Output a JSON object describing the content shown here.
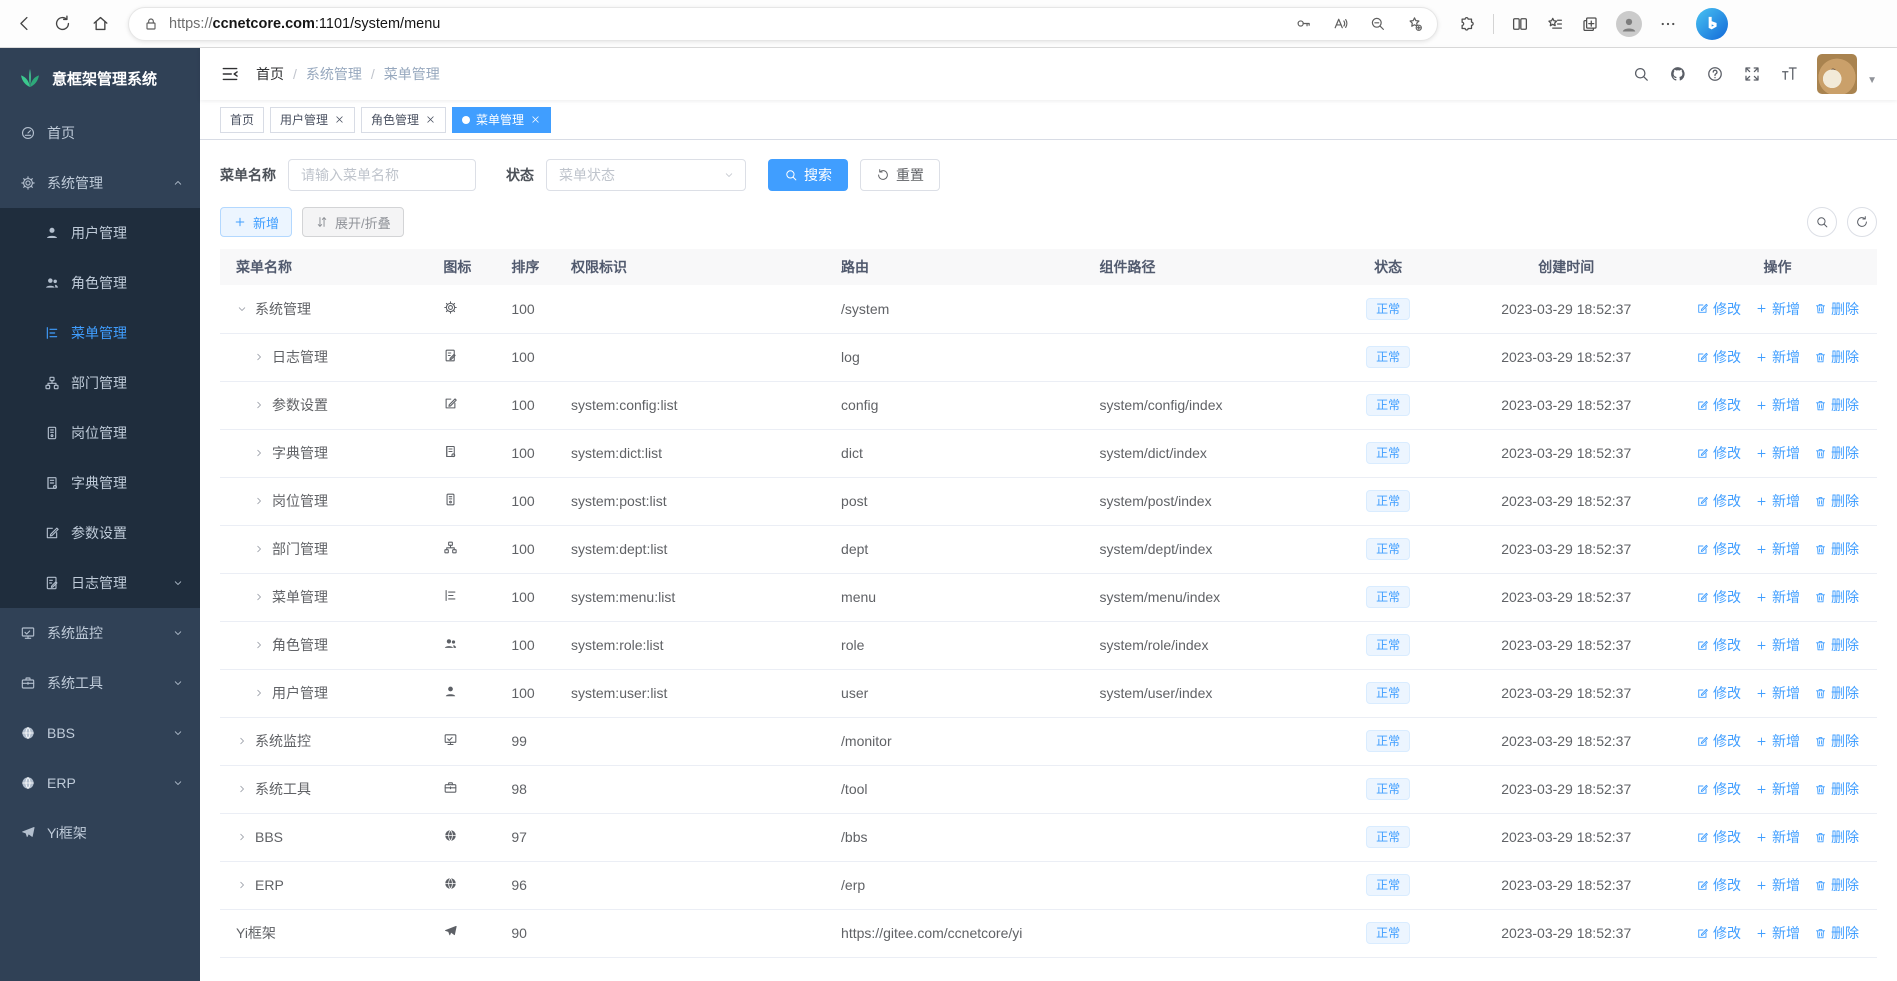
{
  "browser": {
    "url_scheme": "https://",
    "url_host": "ccnetcore.com",
    "url_rest": ":1101/system/menu"
  },
  "sidebar": {
    "logo_title": "意框架管理系统",
    "items": [
      {
        "key": "home",
        "label": "首页",
        "icon": "dashboard"
      },
      {
        "key": "system",
        "label": "系统管理",
        "icon": "gear",
        "chevron": "up",
        "children": [
          {
            "key": "user",
            "label": "用户管理",
            "icon": "user"
          },
          {
            "key": "role",
            "label": "角色管理",
            "icon": "users"
          },
          {
            "key": "menu",
            "label": "菜单管理",
            "icon": "menu-tree",
            "active": true
          },
          {
            "key": "dept",
            "label": "部门管理",
            "icon": "org-tree"
          },
          {
            "key": "post",
            "label": "岗位管理",
            "icon": "badge"
          },
          {
            "key": "dict",
            "label": "字典管理",
            "icon": "book"
          },
          {
            "key": "config",
            "label": "参数设置",
            "icon": "edit-square"
          },
          {
            "key": "log",
            "label": "日志管理",
            "icon": "log-doc",
            "chevron": "down"
          }
        ]
      },
      {
        "key": "monitor",
        "label": "系统监控",
        "icon": "monitor",
        "chevron": "down"
      },
      {
        "key": "tool",
        "label": "系统工具",
        "icon": "briefcase",
        "chevron": "down"
      },
      {
        "key": "bbs",
        "label": "BBS",
        "icon": "globe",
        "chevron": "down"
      },
      {
        "key": "erp",
        "label": "ERP",
        "icon": "globe",
        "chevron": "down"
      },
      {
        "key": "yi",
        "label": "Yi框架",
        "icon": "plane"
      }
    ]
  },
  "header": {
    "breadcrumb": [
      "首页",
      "系统管理",
      "菜单管理"
    ]
  },
  "tabs": [
    {
      "key": "home",
      "label": "首页",
      "closable": false,
      "active": false
    },
    {
      "key": "user",
      "label": "用户管理",
      "closable": true,
      "active": false
    },
    {
      "key": "role",
      "label": "角色管理",
      "closable": true,
      "active": false
    },
    {
      "key": "menu",
      "label": "菜单管理",
      "closable": true,
      "active": true
    }
  ],
  "filters": {
    "name_label": "菜单名称",
    "name_placeholder": "请输入菜单名称",
    "name_value": "",
    "status_label": "状态",
    "status_placeholder": "菜单状态",
    "search_label": "搜索",
    "reset_label": "重置"
  },
  "toolbar": {
    "add_label": "新增",
    "expand_label": "展开/折叠"
  },
  "table": {
    "columns": [
      "菜单名称",
      "图标",
      "排序",
      "权限标识",
      "路由",
      "组件路径",
      "状态",
      "创建时间",
      "操作"
    ],
    "row_actions": [
      {
        "key": "edit",
        "label": "修改",
        "icon": "edit-pen"
      },
      {
        "key": "add",
        "label": "新增",
        "icon": "plus"
      },
      {
        "key": "delete",
        "label": "删除",
        "icon": "trash"
      }
    ],
    "rows": [
      {
        "name": "系统管理",
        "level": 0,
        "arrow": "down",
        "icon": "gear",
        "order": "100",
        "perms": "",
        "route": "/system",
        "component": "",
        "status": "正常",
        "created": "2023-03-29 18:52:37"
      },
      {
        "name": "日志管理",
        "level": 1,
        "arrow": "right",
        "icon": "log-doc",
        "order": "100",
        "perms": "",
        "route": "log",
        "component": "",
        "status": "正常",
        "created": "2023-03-29 18:52:37"
      },
      {
        "name": "参数设置",
        "level": 1,
        "arrow": "right",
        "icon": "edit-square",
        "order": "100",
        "perms": "system:config:list",
        "route": "config",
        "component": "system/config/index",
        "status": "正常",
        "created": "2023-03-29 18:52:37"
      },
      {
        "name": "字典管理",
        "level": 1,
        "arrow": "right",
        "icon": "book",
        "order": "100",
        "perms": "system:dict:list",
        "route": "dict",
        "component": "system/dict/index",
        "status": "正常",
        "created": "2023-03-29 18:52:37"
      },
      {
        "name": "岗位管理",
        "level": 1,
        "arrow": "right",
        "icon": "badge",
        "order": "100",
        "perms": "system:post:list",
        "route": "post",
        "component": "system/post/index",
        "status": "正常",
        "created": "2023-03-29 18:52:37"
      },
      {
        "name": "部门管理",
        "level": 1,
        "arrow": "right",
        "icon": "org-tree",
        "order": "100",
        "perms": "system:dept:list",
        "route": "dept",
        "component": "system/dept/index",
        "status": "正常",
        "created": "2023-03-29 18:52:37"
      },
      {
        "name": "菜单管理",
        "level": 1,
        "arrow": "right",
        "icon": "menu-tree",
        "order": "100",
        "perms": "system:menu:list",
        "route": "menu",
        "component": "system/menu/index",
        "status": "正常",
        "created": "2023-03-29 18:52:37"
      },
      {
        "name": "角色管理",
        "level": 1,
        "arrow": "right",
        "icon": "users",
        "order": "100",
        "perms": "system:role:list",
        "route": "role",
        "component": "system/role/index",
        "status": "正常",
        "created": "2023-03-29 18:52:37"
      },
      {
        "name": "用户管理",
        "level": 1,
        "arrow": "right",
        "icon": "user",
        "order": "100",
        "perms": "system:user:list",
        "route": "user",
        "component": "system/user/index",
        "status": "正常",
        "created": "2023-03-29 18:52:37"
      },
      {
        "name": "系统监控",
        "level": 0,
        "arrow": "right",
        "icon": "monitor",
        "order": "99",
        "perms": "",
        "route": "/monitor",
        "component": "",
        "status": "正常",
        "created": "2023-03-29 18:52:37"
      },
      {
        "name": "系统工具",
        "level": 0,
        "arrow": "right",
        "icon": "briefcase",
        "order": "98",
        "perms": "",
        "route": "/tool",
        "component": "",
        "status": "正常",
        "created": "2023-03-29 18:52:37"
      },
      {
        "name": "BBS",
        "level": 0,
        "arrow": "right",
        "icon": "globe",
        "order": "97",
        "perms": "",
        "route": "/bbs",
        "component": "",
        "status": "正常",
        "created": "2023-03-29 18:52:37"
      },
      {
        "name": "ERP",
        "level": 0,
        "arrow": "right",
        "icon": "globe",
        "order": "96",
        "perms": "",
        "route": "/erp",
        "component": "",
        "status": "正常",
        "created": "2023-03-29 18:52:37"
      },
      {
        "name": "Yi框架",
        "level": 0,
        "arrow": "none",
        "icon": "plane",
        "order": "90",
        "perms": "",
        "route": "https://gitee.com/ccnetcore/yi",
        "component": "",
        "status": "正常",
        "created": "2023-03-29 18:52:37"
      }
    ]
  },
  "colors": {
    "primary": "#409eff",
    "sidebar_bg": "#304156",
    "submenu_bg": "#1f2d3d",
    "status_tag_bg": "#ecf5ff",
    "status_tag_border": "#d9ecff",
    "tab_active_bg": "#409eff"
  }
}
